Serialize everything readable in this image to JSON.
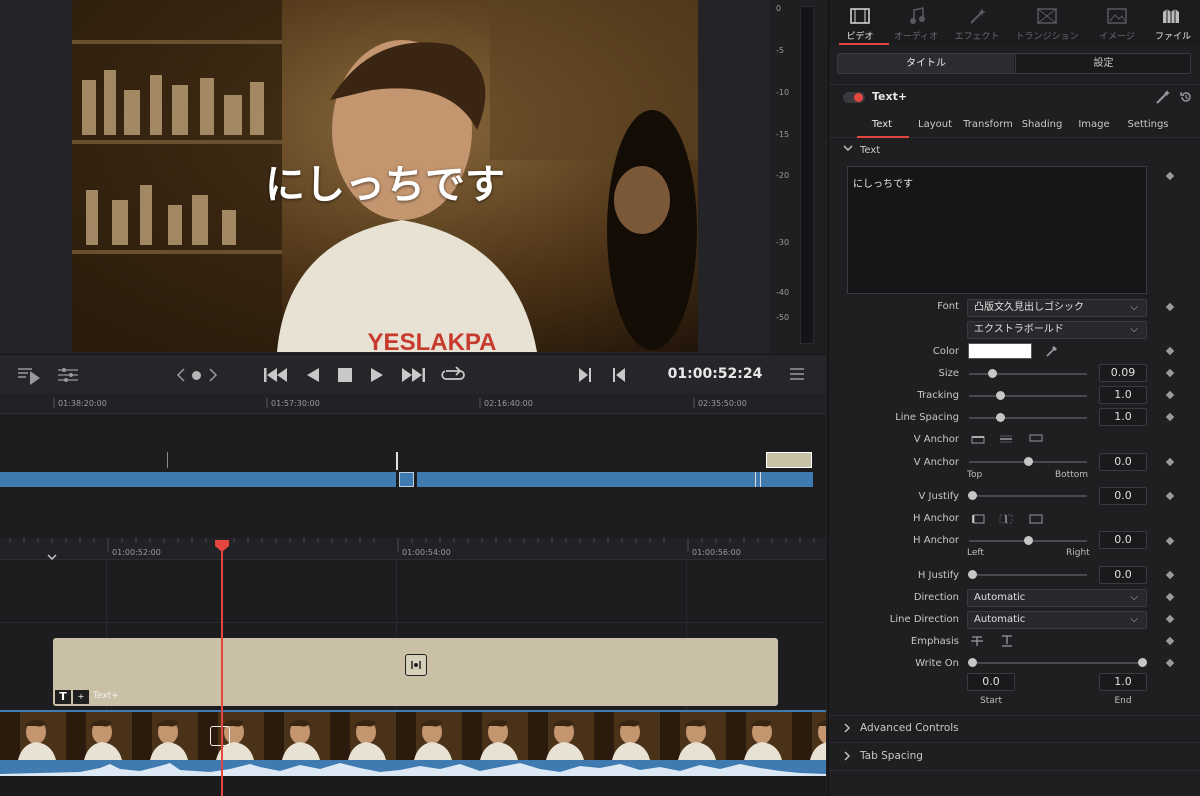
{
  "viewer": {
    "overlay_text": "にしっちです",
    "timecode": "01:00:52:24"
  },
  "meter": {
    "ticks": [
      "0",
      "-5",
      "-10",
      "-15",
      "-20",
      "-30",
      "-40",
      "-50"
    ]
  },
  "inspector": {
    "top_tabs": [
      {
        "label": "ビデオ",
        "icon": "film-icon",
        "active": true
      },
      {
        "label": "オーディオ",
        "icon": "music-note-icon",
        "active": false
      },
      {
        "label": "エフェクト",
        "icon": "magic-wand-icon",
        "active": false
      },
      {
        "label": "トランジション",
        "icon": "transition-icon",
        "active": false
      },
      {
        "label": "イメージ",
        "icon": "image-icon",
        "active": false
      },
      {
        "label": "ファイル",
        "icon": "file-icon",
        "active": true
      }
    ],
    "segments": {
      "title": "タイトル",
      "settings": "設定"
    },
    "effect_name": "Text+",
    "sub_tabs": [
      "Text",
      "Layout",
      "Transform",
      "Shading",
      "Image",
      "Settings"
    ],
    "section_text": "Text",
    "text_value": "にしっちです",
    "font_label": "Font",
    "font_family": "凸版文久見出しゴシック",
    "font_style": "エクストラボールド",
    "color_label": "Color",
    "size_label": "Size",
    "size_value": "0.09",
    "tracking_label": "Tracking",
    "tracking_value": "1.0",
    "line_spacing_label": "Line Spacing",
    "line_spacing_value": "1.0",
    "v_anchor_label": "V Anchor",
    "v_anchor_value": "0.0",
    "v_top": "Top",
    "v_bottom": "Bottom",
    "v_justify_label": "V Justify",
    "v_justify_value": "0.0",
    "h_anchor_label": "H Anchor",
    "h_anchor_value": "0.0",
    "h_left": "Left",
    "h_right": "Right",
    "h_justify_label": "H Justify",
    "h_justify_value": "0.0",
    "direction_label": "Direction",
    "direction_value": "Automatic",
    "line_direction_label": "Line Direction",
    "line_direction_value": "Automatic",
    "emphasis_label": "Emphasis",
    "write_on_label": "Write On",
    "write_on_start": "0.0",
    "write_on_end": "1.0",
    "start_label": "Start",
    "end_label": "End",
    "advanced_controls": "Advanced Controls",
    "tab_spacing": "Tab Spacing"
  },
  "timeline": {
    "overview_ticks": [
      "01:38:20:00",
      "01:57:30:00",
      "02:16:40:00",
      "02:35:50:00"
    ],
    "detail_ticks": [
      "01:00:52:00",
      "01:00:54:00",
      "01:00:56:00"
    ],
    "title_clip_label": "Text+"
  },
  "colors": {
    "accent": "#e2463e",
    "clip_blue": "#3f7bb1",
    "title_clip": "#c9c0a6",
    "wave": "#dce8f3"
  }
}
